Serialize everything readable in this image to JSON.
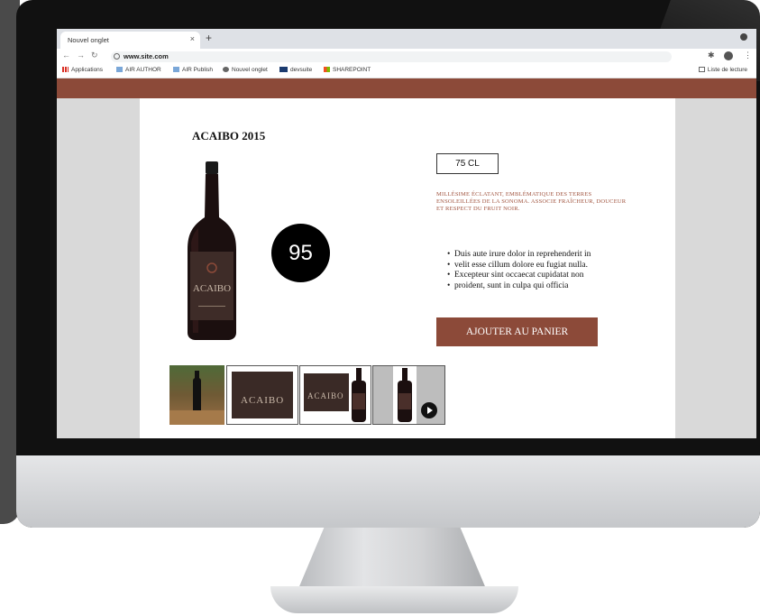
{
  "browser": {
    "tab_title": "Nouvel onglet",
    "tab_close": "×",
    "new_tab": "+",
    "url": "www.site.com",
    "bookmarks": [
      "Applications",
      "AIR AUTHOR",
      "AIR Publish",
      "Nouvel onglet",
      "devsuite",
      "SHAREPOINT"
    ],
    "reading_list": "Liste de lecture"
  },
  "product": {
    "title": "ACAIBO 2015",
    "score": "95",
    "volume": "75 CL",
    "description": "MILLÉSIME ÉCLATANT, EMBLÉMATIQUE DES TERRES ENSOLEILLÉES DE LA SONOMA. ASSOCIE FRAÎCHEUR, DOUCEUR ET RESPECT DU FRUIT NOIR.",
    "bullets": [
      "Duis aute irure dolor in reprehenderit in",
      "velit esse cillum dolore eu fugiat nulla.",
      "Excepteur sint occaecat cupidatat non",
      "proident, sunt in culpa qui officia"
    ],
    "cart_button": "AJOUTER AU PANIER",
    "label_brand": "ACAIBO"
  },
  "colors": {
    "brand": "#8c4a39",
    "sidebar": "#d9d9d9"
  }
}
